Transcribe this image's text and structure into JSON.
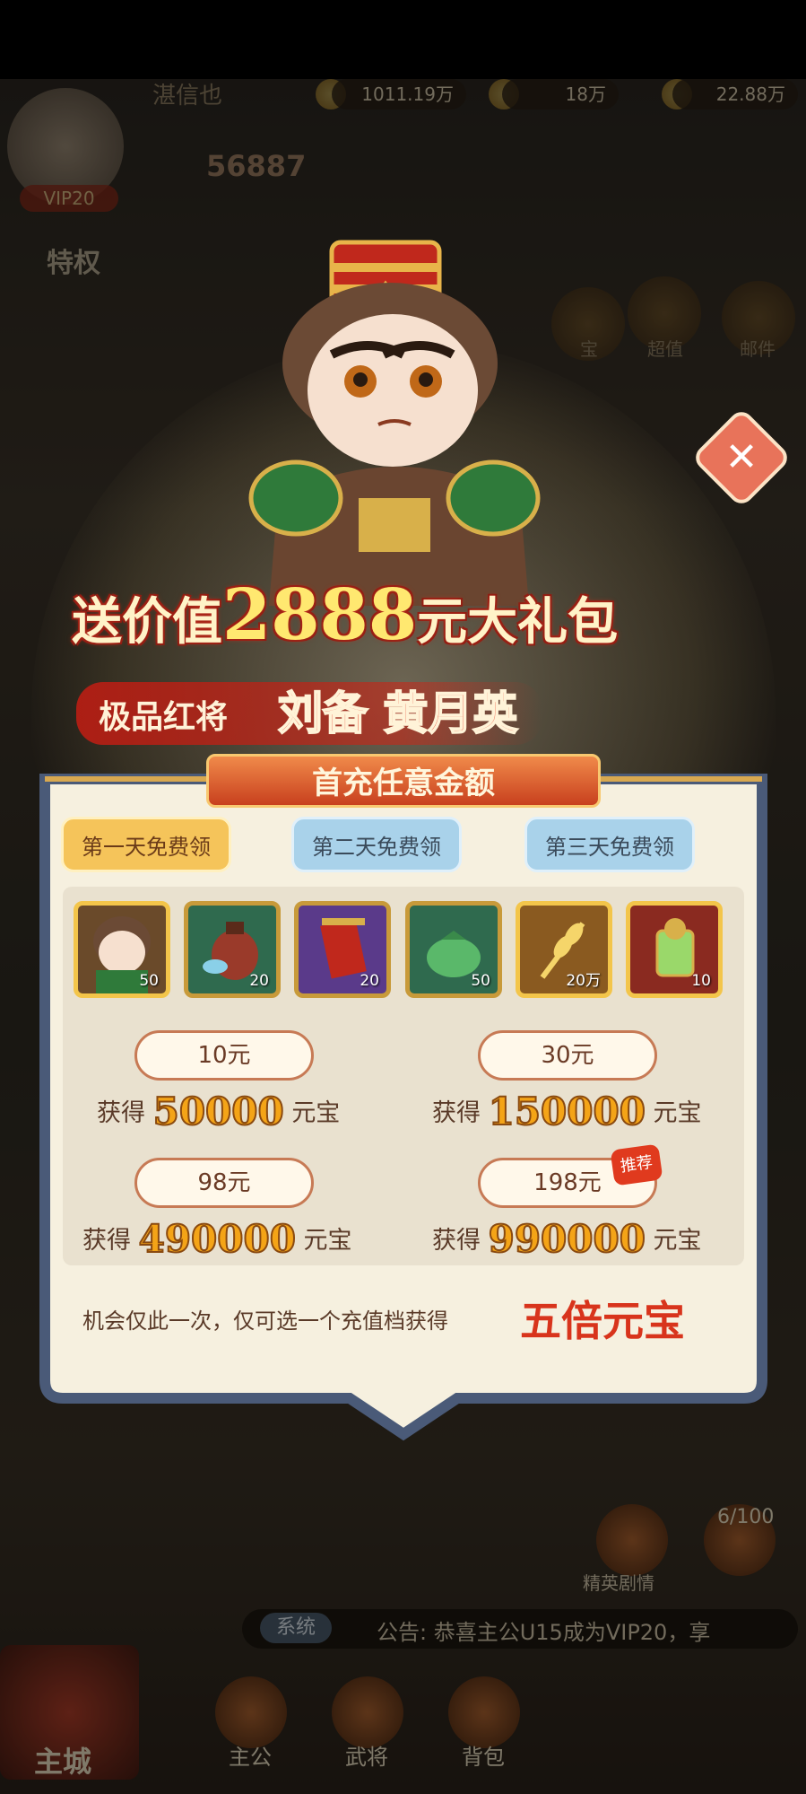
{
  "hud": {
    "player_name": "湛信也",
    "vip_label": "VIP20",
    "power": "56887",
    "resource1": "1011.19万",
    "resource2": "18万",
    "resource3": "22.88万",
    "privilege_label": "特权"
  },
  "side_buttons": [
    "宝",
    "超值",
    "邮件"
  ],
  "popup": {
    "title_prefix": "送价值",
    "title_amount": "2888",
    "title_suffix": "元大礼包",
    "subtitle_tag": "极品红将",
    "hero_names": "刘备 黄月英",
    "ribbon": "首充任意金额",
    "close_label": "✕",
    "tabs": [
      "第一天免费领",
      "第二天免费领",
      "第三天免费领"
    ],
    "items": [
      {
        "icon": "hero-portrait-icon",
        "count": "50",
        "bg": "#6a4a2a"
      },
      {
        "icon": "wine-jar-icon",
        "count": "20",
        "bg": "#2f6a4e"
      },
      {
        "icon": "scroll-icon",
        "count": "20",
        "bg": "#5a3a8a"
      },
      {
        "icon": "green-bag-icon",
        "count": "50",
        "bg": "#2f6a4e"
      },
      {
        "icon": "wheat-icon",
        "count": "20万",
        "bg": "#8a5a20"
      },
      {
        "icon": "token-icon",
        "count": "10",
        "bg": "#8a2a20"
      }
    ],
    "tiers": [
      {
        "price": "10元",
        "gain_label": "获得",
        "amount": "50000",
        "unit": "元宝"
      },
      {
        "price": "30元",
        "gain_label": "获得",
        "amount": "150000",
        "unit": "元宝"
      },
      {
        "price": "98元",
        "gain_label": "获得",
        "amount": "490000",
        "unit": "元宝"
      },
      {
        "price": "198元",
        "gain_label": "获得",
        "amount": "990000",
        "unit": "元宝",
        "badge": "推荐"
      }
    ],
    "note": "机会仅此一次，仅可选一个充值档获得",
    "note_highlight": "五倍元宝"
  },
  "notice": {
    "channel": "系统",
    "text": "公告: 恭喜主公U15成为VIP20，享"
  },
  "bottom_nav": [
    "主城",
    "主公",
    "武将",
    "背包"
  ],
  "side_bottom": [
    "精英剧情",
    "6/100"
  ],
  "colors": {
    "accent": "#e03a1e",
    "tab_active": "#f5c45a",
    "tab_inactive": "#a9d2ea",
    "panel": "#f6f0df"
  }
}
